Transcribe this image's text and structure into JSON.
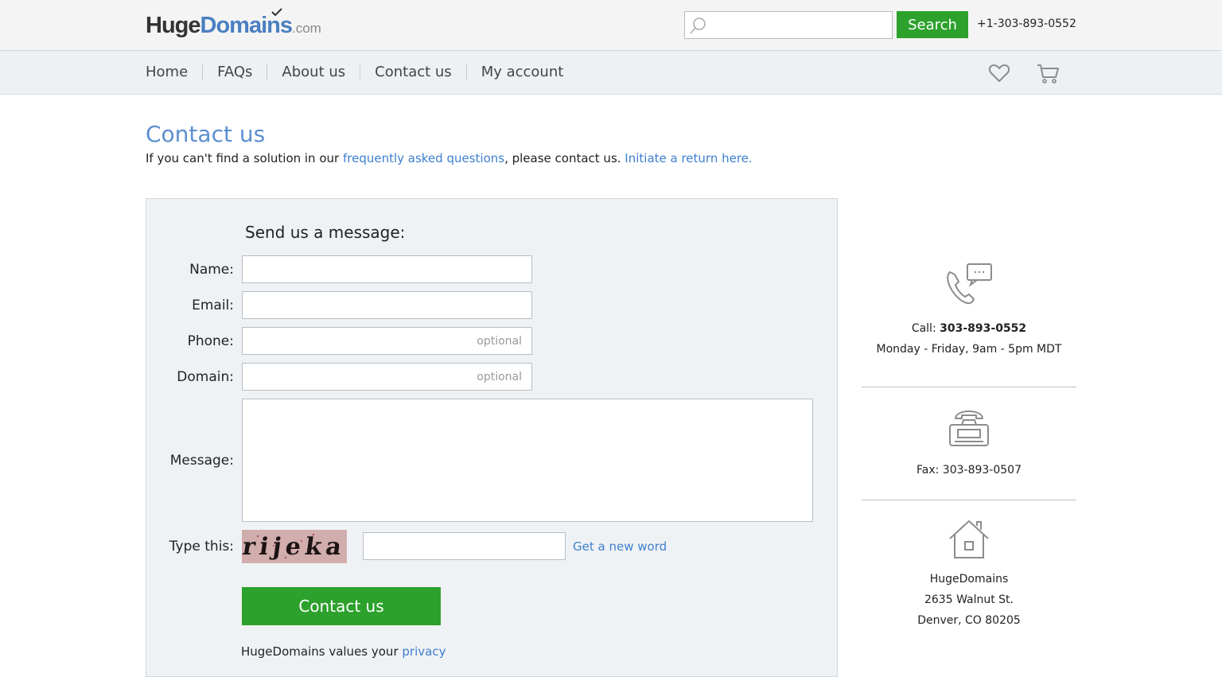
{
  "header": {
    "logo": {
      "huge": "Huge",
      "domains": "Domains",
      "com": ".com"
    },
    "search": {
      "placeholder": "",
      "button_label": "Search"
    },
    "phone": "+1-303-893-0552"
  },
  "nav": {
    "items": [
      {
        "label": "Home"
      },
      {
        "label": "FAQs"
      },
      {
        "label": "About us"
      },
      {
        "label": "Contact us"
      },
      {
        "label": "My account"
      }
    ],
    "icons": [
      "heart-icon",
      "cart-icon"
    ]
  },
  "page": {
    "title": "Contact us",
    "intro_prefix": "If you can't find a solution in our ",
    "faq_link": "frequently asked questions",
    "intro_middle": ", please contact us. ",
    "return_link": "Initiate a return here."
  },
  "form": {
    "heading": "Send us a message:",
    "name_label": "Name:",
    "email_label": "Email:",
    "phone_label": "Phone:",
    "phone_placeholder": "optional",
    "domain_label": "Domain:",
    "domain_placeholder": "optional",
    "message_label": "Message:",
    "captcha_label": "Type this:",
    "captcha_word": "rijeka",
    "new_word_link": "Get a new word",
    "submit_label": "Contact us",
    "privacy_prefix": "HugeDomains values your ",
    "privacy_link": "privacy"
  },
  "sidebar": {
    "call_prefix": "Call: ",
    "call_number": "303-893-0552",
    "hours": "Monday - Friday, 9am - 5pm MDT",
    "fax": "Fax: 303-893-0507",
    "company": "HugeDomains",
    "street": "2635 Walnut St.",
    "city": "Denver, CO 80205"
  },
  "colors": {
    "accent_green": "#2ca12c",
    "link_blue": "#3d7fcf",
    "title_blue": "#5b8fd0",
    "form_bg": "#eff2f4"
  }
}
